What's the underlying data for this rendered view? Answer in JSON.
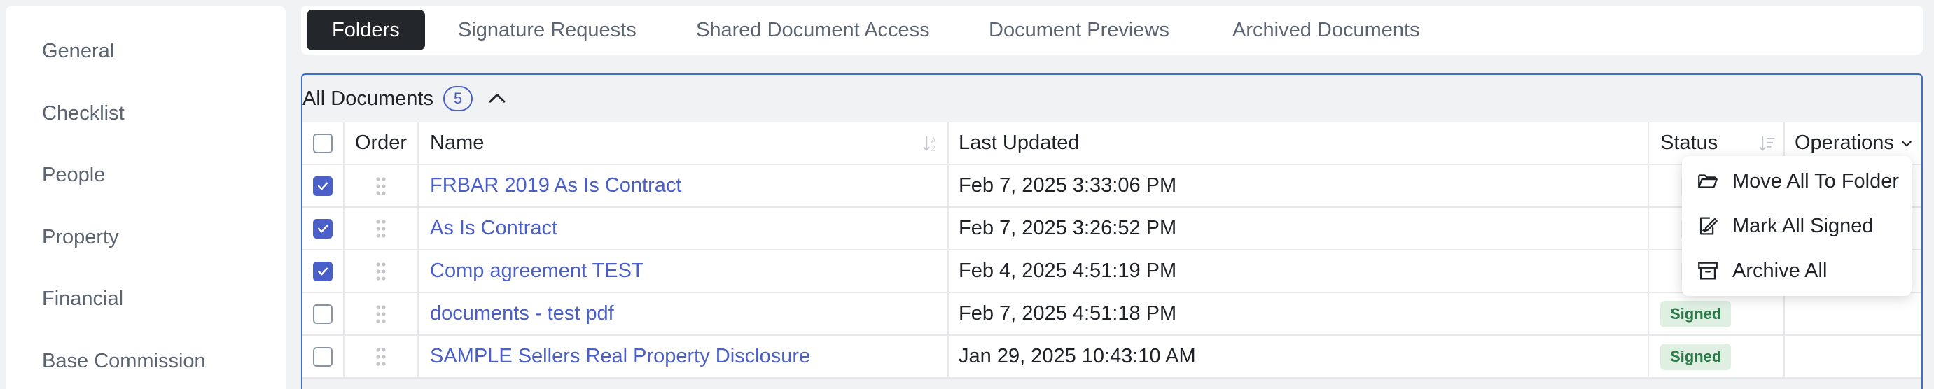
{
  "sidebar": {
    "items": [
      {
        "label": "General"
      },
      {
        "label": "Checklist"
      },
      {
        "label": "People"
      },
      {
        "label": "Property"
      },
      {
        "label": "Financial"
      },
      {
        "label": "Base Commission"
      }
    ]
  },
  "tabs": [
    {
      "label": "Folders",
      "active": true
    },
    {
      "label": "Signature Requests",
      "active": false
    },
    {
      "label": "Shared Document Access",
      "active": false
    },
    {
      "label": "Document Previews",
      "active": false
    },
    {
      "label": "Archived Documents",
      "active": false
    }
  ],
  "panel": {
    "title": "All Documents",
    "count": "5"
  },
  "table": {
    "headers": {
      "order": "Order",
      "name": "Name",
      "last_updated": "Last Updated",
      "status": "Status",
      "operations": "Operations"
    },
    "rows": [
      {
        "checked": true,
        "name": "FRBAR 2019 As Is Contract",
        "last_updated": "Feb 7, 2025 3:33:06 PM",
        "status": ""
      },
      {
        "checked": true,
        "name": "As Is Contract",
        "last_updated": "Feb 7, 2025 3:26:52 PM",
        "status": ""
      },
      {
        "checked": true,
        "name": "Comp agreement TEST",
        "last_updated": "Feb 4, 2025 4:51:19 PM",
        "status": ""
      },
      {
        "checked": false,
        "name": "documents - test pdf",
        "last_updated": "Feb 7, 2025 4:51:18 PM",
        "status": "Signed"
      },
      {
        "checked": false,
        "name": "SAMPLE Sellers Real Property Disclosure",
        "last_updated": "Jan 29, 2025 10:43:10 AM",
        "status": "Signed"
      }
    ]
  },
  "operations_menu": {
    "items": [
      {
        "label": "Move All To Folder",
        "icon": "folder-open-icon"
      },
      {
        "label": "Mark All Signed",
        "icon": "signature-icon"
      },
      {
        "label": "Archive All",
        "icon": "archive-icon"
      }
    ]
  },
  "colors": {
    "accent": "#4b5fc9",
    "active_tab": "#23262b",
    "signed_bg": "#dff0e3",
    "signed_text": "#2c7a4a",
    "panel_border": "#3e6fc4"
  }
}
